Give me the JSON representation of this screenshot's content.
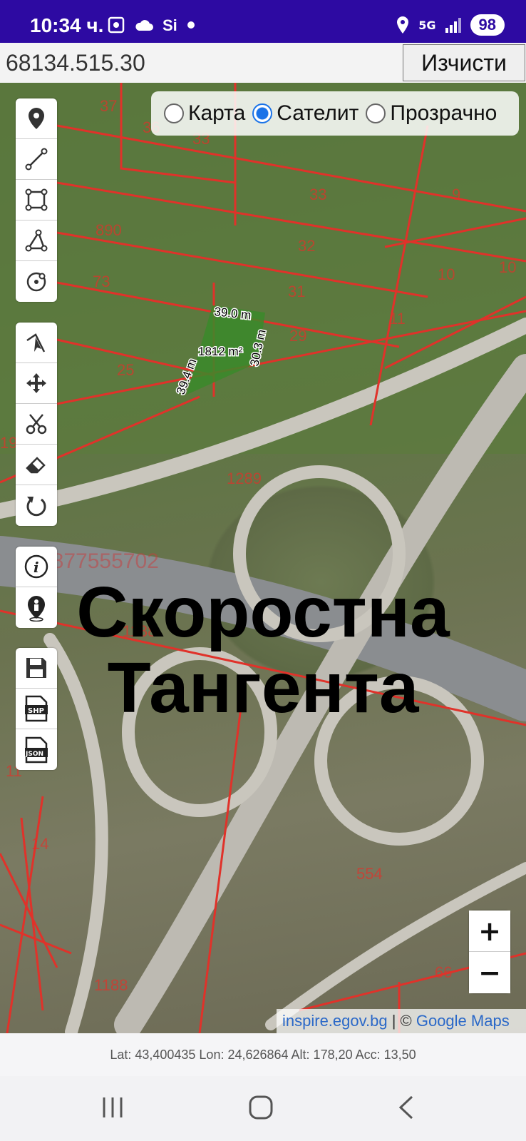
{
  "status_bar": {
    "time": "10:34 ч.",
    "network": "5G",
    "battery": "98",
    "icons": [
      "screenshot-icon",
      "cloud-icon",
      "sim-icon",
      "dot-icon",
      "location-icon",
      "signal-icon"
    ]
  },
  "search": {
    "value": "68134.515.30",
    "clear_label": "Изчисти"
  },
  "layers": {
    "options": [
      "Карта",
      "Сателит",
      "Прозрачно"
    ],
    "selected": "Сателит"
  },
  "toolbar_groups": [
    [
      "marker-icon",
      "line-icon",
      "polygon-icon",
      "angle-icon",
      "circle-icon"
    ],
    [
      "edit-vertices-icon",
      "move-icon",
      "cut-icon",
      "eraser-icon",
      "rotate-icon"
    ],
    [
      "info-icon",
      "person-location-icon"
    ],
    [
      "save-icon",
      "shp-export-icon",
      "json-export-icon"
    ]
  ],
  "map": {
    "parcel_labels": [
      "37",
      "36",
      "33",
      "33",
      "9",
      "890",
      "32",
      "73",
      "31",
      "10",
      "10",
      "11",
      "29",
      "25",
      "19",
      "1289",
      "1188",
      "554",
      "11",
      "14",
      "66",
      "1188"
    ],
    "measure": {
      "top": "39.0 m",
      "right": "30.3 m",
      "left": "39.4 m",
      "area": "1812 m²"
    },
    "watermark": "0877555702",
    "overlay_title_line1": "Скоростна",
    "overlay_title_line2": "Тангента"
  },
  "zoom": {
    "in": "+",
    "out": "−"
  },
  "attribution": {
    "inspire": "inspire.egov.bg",
    "separator": " | © ",
    "google": "Google Maps"
  },
  "location_readout": "Lat: 43,400435 Lon: 24,626864 Alt: 178,20 Acc: 13,50",
  "colors": {
    "status_bar": "#2d0aa2",
    "parcel_lines": "#e0322a",
    "selected_radio": "#1a73e8",
    "measured_polygon": "#3a8a2a"
  }
}
